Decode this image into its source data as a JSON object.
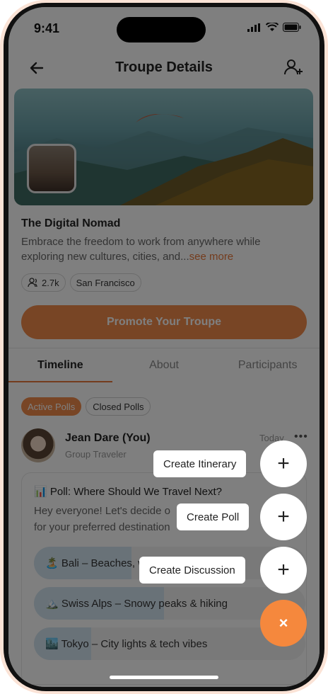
{
  "status_bar": {
    "time": "9:41"
  },
  "header": {
    "title": "Troupe Details"
  },
  "group": {
    "name": "The Digital Nomad",
    "description": "Embrace the freedom to work from anywhere while exploring new cultures, cities, and...",
    "see_more": "see more",
    "members": "2.7k",
    "location": "San Francisco"
  },
  "promote_button": "Promote Your Troupe",
  "tabs": [
    {
      "label": "Timeline"
    },
    {
      "label": "About"
    },
    {
      "label": "Participants"
    }
  ],
  "poll_tabs": [
    {
      "label": "Active Polls"
    },
    {
      "label": "Closed Polls"
    }
  ],
  "post": {
    "author": "Jean Dare (You)",
    "role": "Group Traveler",
    "time": "Today",
    "poll_title": "📊 Poll: Where Should We Travel Next?",
    "body_line1": "Hey everyone! Let's decide o",
    "body_line2": "for your preferred destination"
  },
  "poll_options": [
    {
      "label": "🏝️ Bali – Beaches, w",
      "fill": 0.36
    },
    {
      "label": "🏔️ Swiss Alps – Snowy peaks & hiking",
      "fill": 0.48
    },
    {
      "label": "🏙️ Tokyo – City lights & tech vibes",
      "fill": 0.21
    }
  ],
  "fab_actions": [
    {
      "label": "Create Itinerary"
    },
    {
      "label": "Create Poll"
    },
    {
      "label": "Create Discussion"
    }
  ],
  "fab_close": "×",
  "fab_plus": "+"
}
